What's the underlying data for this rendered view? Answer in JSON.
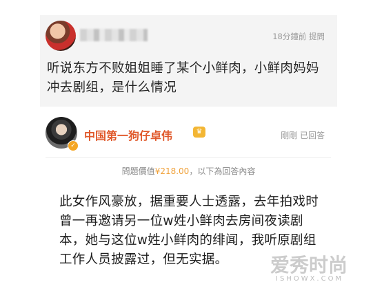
{
  "question": {
    "avatar_icon": "user-avatar-icon",
    "time_label": "18分鐘前 提問",
    "text": "听说东方不败姐姐睡了某个小鲜肉，小鲜肉妈妈冲去剧组，是什么情况"
  },
  "answer": {
    "avatar_icon": "user-avatar-icon",
    "verified_icon": "verified-badge-icon",
    "name": "中国第一狗仔卓伟",
    "vip_icon": "vip-badge-icon",
    "status": "剛剛 已回答",
    "price_prefix": "問題價值",
    "price_value": "¥218.00",
    "price_suffix": "，以下為回答內容",
    "body": "此女作风豪放，据重要人士透露，去年拍戏时曾一再邀请另一位w姓小鲜肉去房间夜读剧本，她与这位w姓小鲜肉的绯闻，我听原剧组工作人员披露过，但无实据。"
  },
  "watermark": {
    "big": "爱秀时尚",
    "small": "ISHOWX.COM"
  },
  "colors": {
    "accent_name": "#e0582a",
    "price": "#f0a23b",
    "question_bg": "#f4f4f4"
  }
}
